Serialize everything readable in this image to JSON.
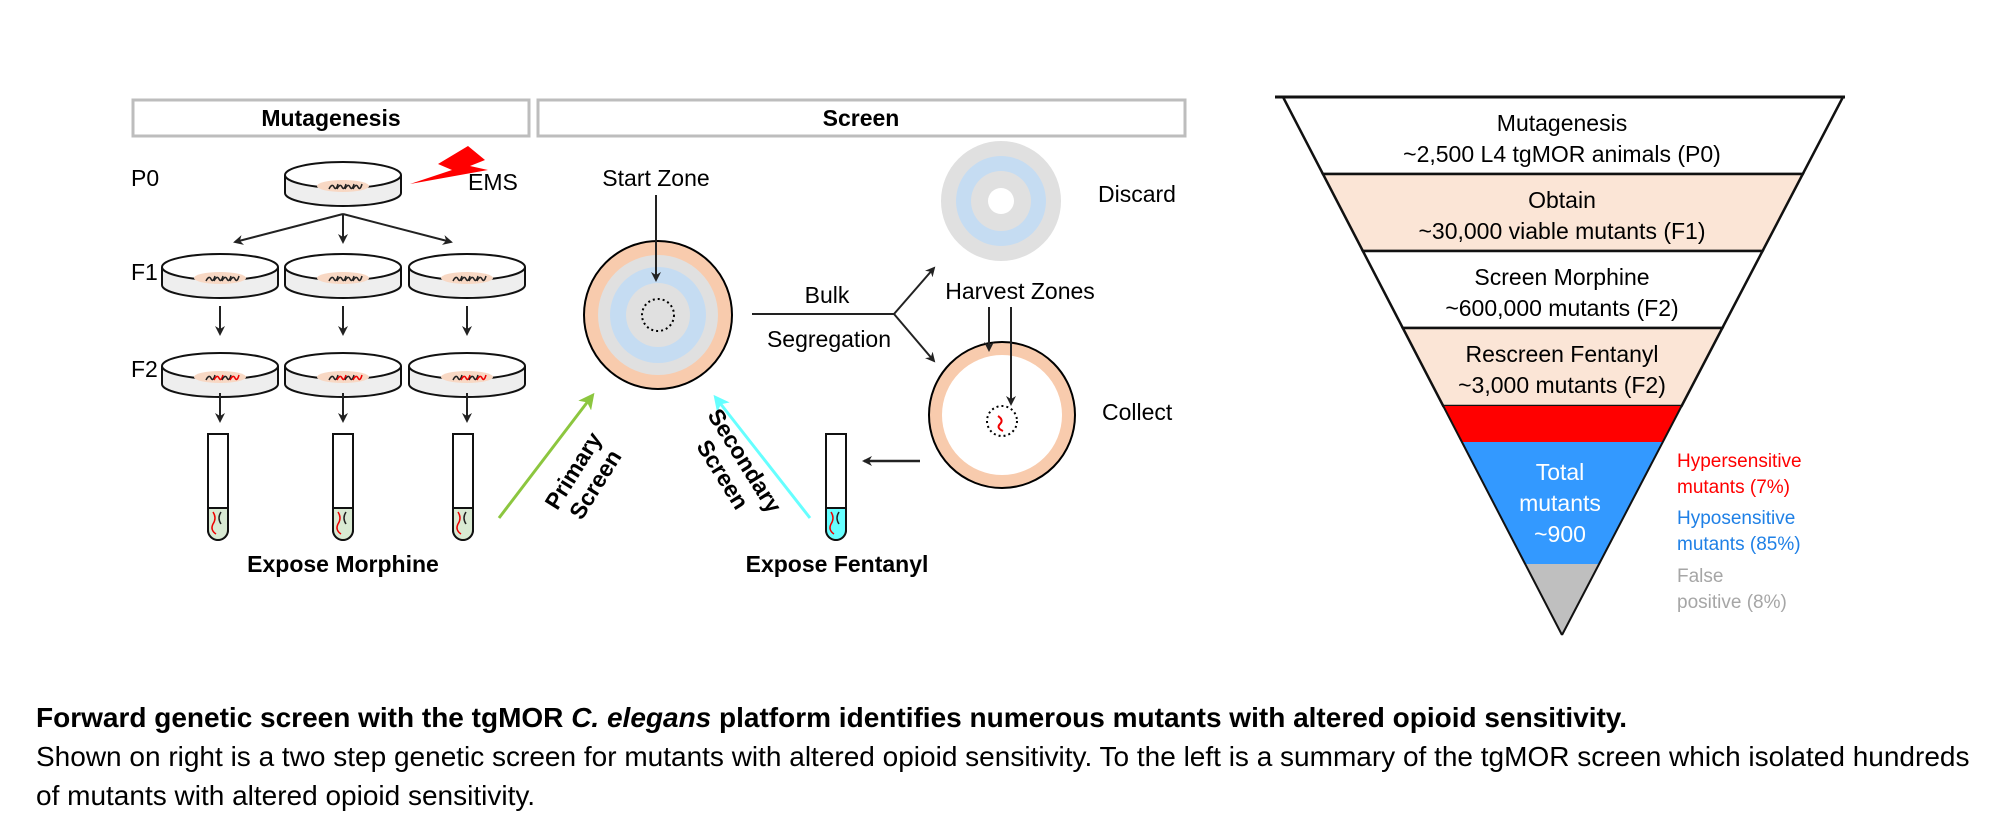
{
  "colors": {
    "hypersensitive": "#ff0000",
    "hyposensitive": "#3399ff",
    "false_positive": "#bfbfbf",
    "band": "#fbe5d6",
    "primary_arrow": "#8cc63f",
    "secondary_arrow": "#66ffff",
    "plate_outer": "#f8cbad",
    "plate_blue": "#c5dcf2",
    "plate_grey": "#e0e0e0"
  },
  "left": {
    "headers": {
      "mutagenesis": "Mutagenesis",
      "screen": "Screen"
    },
    "generations": {
      "p0": "P0",
      "f1": "F1",
      "f2": "F2"
    },
    "ems": "EMS",
    "expose_morphine": "Expose Morphine",
    "expose_fentanyl": "Expose Fentanyl",
    "primary_screen": [
      "Primary",
      "Screen"
    ],
    "secondary_screen": [
      "Secondary",
      "Screen"
    ],
    "start_zone": "Start Zone",
    "bulk": "Bulk",
    "segregation": "Segregation",
    "discard": "Discard",
    "harvest_zones": "Harvest Zones",
    "collect": "Collect"
  },
  "funnel": {
    "tiers": [
      {
        "lines": [
          "Mutagenesis",
          "~2,500 L4 tgMOR animals (P0)"
        ],
        "fill": "#ffffff"
      },
      {
        "lines": [
          "Obtain",
          "~30,000 viable mutants (F1)"
        ],
        "fill": "#fbe5d6"
      },
      {
        "lines": [
          "Screen Morphine",
          "~600,000 mutants (F2)"
        ],
        "fill": "#ffffff"
      },
      {
        "lines": [
          "Rescreen Fentanyl",
          "~3,000 mutants (F2)"
        ],
        "fill": "#fbe5d6"
      }
    ],
    "total": [
      "Total",
      "mutants",
      "~900"
    ],
    "outcomes": [
      {
        "lines": [
          "Hypersensitive",
          "mutants (7%)"
        ],
        "percent": 7,
        "color": "#ff0000"
      },
      {
        "lines": [
          "Hyposensitive",
          "mutants (85%)"
        ],
        "percent": 85,
        "color": "#1f80e6"
      },
      {
        "lines": [
          "False",
          "positive (8%)"
        ],
        "percent": 8,
        "color": "#a6a6a6"
      }
    ]
  },
  "caption": {
    "title_pre": "Forward genetic screen with the tgMOR ",
    "title_italic": "C. elegans",
    "title_post": " platform identifies numerous mutants with altered opioid sensitivity.",
    "body": "Shown on right is a two step genetic screen for mutants with altered opioid sensitivity. To the left is a summary of the tgMOR screen which isolated hundreds of mutants with altered opioid sensitivity."
  }
}
